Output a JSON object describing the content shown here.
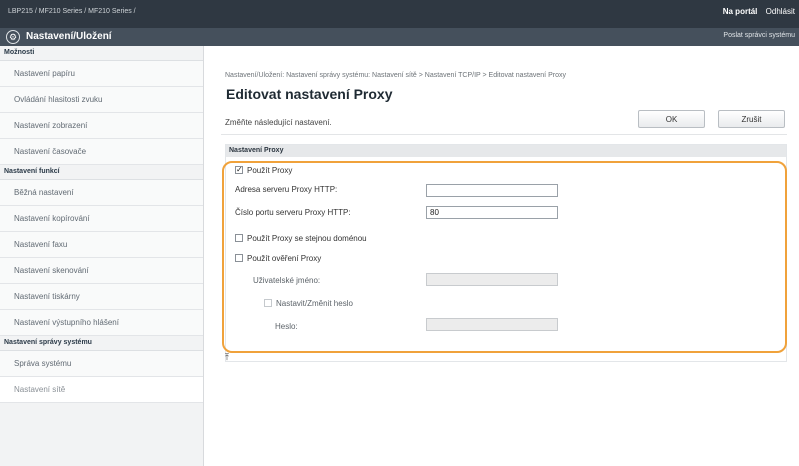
{
  "header": {
    "product": "LBP215 / MF210 Series / MF210 Series /",
    "portal_link": "Na portál",
    "logout_link": "Odhlásit",
    "app_title": "Nastavení/Uložení",
    "admin_mail_link": "Poslat správci systému"
  },
  "sidebar": {
    "sections": [
      {
        "title": "Možnosti",
        "items": [
          {
            "label": "Nastavení papíru"
          },
          {
            "label": "Ovládání hlasitosti zvuku"
          },
          {
            "label": "Nastavení zobrazení"
          },
          {
            "label": "Nastavení časovače"
          }
        ]
      },
      {
        "title": "Nastavení funkcí",
        "items": [
          {
            "label": "Běžná nastavení"
          },
          {
            "label": "Nastavení kopírování"
          },
          {
            "label": "Nastavení faxu"
          },
          {
            "label": "Nastavení skenování"
          },
          {
            "label": "Nastavení tiskárny"
          },
          {
            "label": "Nastavení výstupního hlášení"
          }
        ]
      },
      {
        "title": "Nastavení správy systému",
        "items": [
          {
            "label": "Správa systému"
          },
          {
            "label": "Nastavení sítě"
          }
        ]
      }
    ]
  },
  "main": {
    "breadcrumb": "Nastavení/Uložení: Nastavení správy systému: Nastavení sítě > Nastavení TCP/IP > Editovat nastavení Proxy",
    "title": "Editovat nastavení Proxy",
    "instruction": "Změňte následující nastavení.",
    "ok_label": "OK",
    "cancel_label": "Zrušit",
    "section_title": "Nastavení Proxy",
    "use_proxy": {
      "label": "Použít Proxy",
      "checked": true
    },
    "http_address": {
      "label": "Adresa serveru Proxy HTTP:",
      "value": ""
    },
    "http_port": {
      "label": "Číslo portu serveru Proxy HTTP:",
      "value": "80"
    },
    "same_domain": {
      "label": "Použít Proxy se stejnou doménou",
      "checked": false
    },
    "use_auth": {
      "label": "Použít ověření Proxy",
      "checked": false
    },
    "username": {
      "label": "Uživatelské jméno:",
      "value": ""
    },
    "set_password": {
      "label": "Nastavit/Změnit heslo",
      "checked": false
    },
    "password": {
      "label": "Heslo:",
      "value": ""
    },
    "to_top_icon": "to-top-icon"
  },
  "colors": {
    "topbar": "#2f3842",
    "titlebar": "#45505c",
    "highlight": "#f0a23b"
  }
}
